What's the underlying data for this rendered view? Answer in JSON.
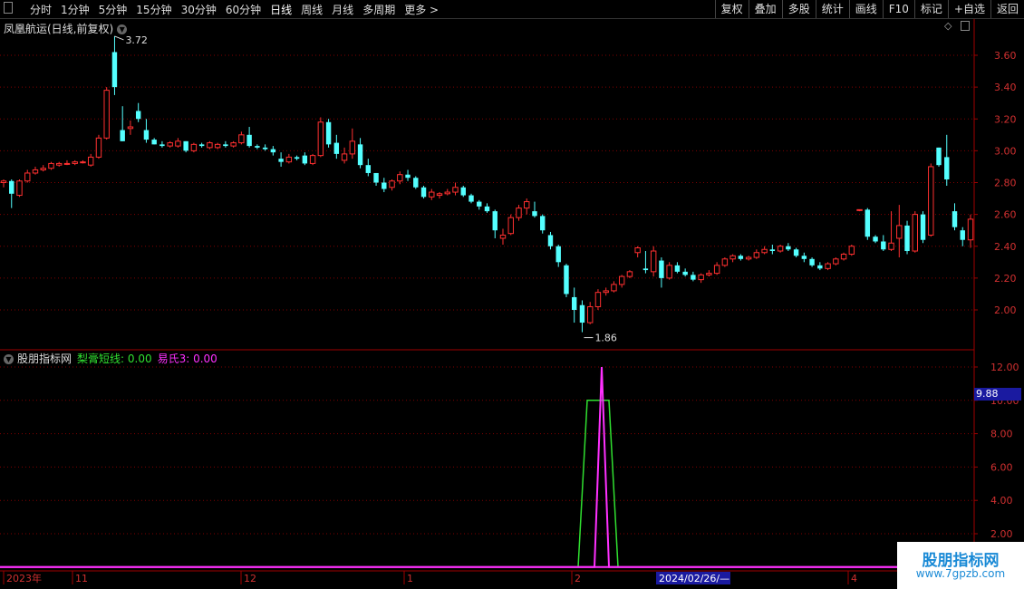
{
  "toolbar": {
    "timeframes": [
      "分时",
      "1分钟",
      "5分钟",
      "15分钟",
      "30分钟",
      "60分钟",
      "日线",
      "周线",
      "月线",
      "多周期",
      "更多 >"
    ],
    "active_timeframe": "日线",
    "tools": [
      "复权",
      "叠加",
      "多股",
      "统计",
      "画线",
      "F10",
      "标记",
      "+自选",
      "返回"
    ]
  },
  "main_chart": {
    "title": "凤凰航运(日线,前复权)",
    "high_label": "3.72",
    "low_label": "1.86",
    "y_ticks": [
      "3.60",
      "3.40",
      "3.20",
      "3.00",
      "2.80",
      "2.60",
      "2.40",
      "2.20",
      "2.00"
    ]
  },
  "indicator": {
    "name": "股朋指标网",
    "series1": "梨膏短线: 0.00",
    "series2": "易氏3: 0.00",
    "y_ticks": [
      "12.00",
      "10.00",
      "8.00",
      "6.00",
      "4.00",
      "2.00"
    ],
    "current_value": "9.88"
  },
  "x_axis": {
    "labels": [
      "2023年",
      "11",
      "12",
      "1",
      "2",
      "4"
    ],
    "cursor_date": "2024/02/26/—"
  },
  "watermark": {
    "title": "股朋指标网",
    "url": "www.7gpzb.com"
  },
  "colors": {
    "up": "#ff3030",
    "down": "#54ffff",
    "grid": "#800000",
    "indicator_green": "#30e030",
    "indicator_magenta": "#ff30ff"
  },
  "chart_data": {
    "type": "candlestick",
    "y_range": [
      1.85,
      3.75
    ],
    "candles": [
      [
        2.8,
        2.82,
        2.77,
        2.81
      ],
      [
        2.81,
        2.82,
        2.64,
        2.73
      ],
      [
        2.72,
        2.82,
        2.71,
        2.81
      ],
      [
        2.81,
        2.88,
        2.8,
        2.86
      ],
      [
        2.86,
        2.9,
        2.85,
        2.88
      ],
      [
        2.88,
        2.91,
        2.87,
        2.89
      ],
      [
        2.89,
        2.93,
        2.88,
        2.92
      ],
      [
        2.91,
        2.93,
        2.9,
        2.92
      ],
      [
        2.92,
        2.94,
        2.91,
        2.92
      ],
      [
        2.92,
        2.94,
        2.91,
        2.93
      ],
      [
        2.93,
        2.94,
        2.92,
        2.93
      ],
      [
        2.91,
        2.98,
        2.9,
        2.96
      ],
      [
        2.96,
        3.1,
        2.95,
        3.08
      ],
      [
        3.08,
        3.4,
        3.07,
        3.38
      ],
      [
        3.62,
        3.72,
        3.35,
        3.4
      ],
      [
        3.13,
        3.28,
        3.06,
        3.06
      ],
      [
        3.14,
        3.19,
        3.1,
        3.15
      ],
      [
        3.25,
        3.3,
        3.18,
        3.2
      ],
      [
        3.13,
        3.2,
        3.05,
        3.07
      ],
      [
        3.07,
        3.08,
        3.04,
        3.04
      ],
      [
        3.04,
        3.06,
        3.02,
        3.03
      ],
      [
        3.03,
        3.06,
        3.02,
        3.05
      ],
      [
        3.03,
        3.08,
        3.02,
        3.06
      ],
      [
        3.06,
        3.06,
        2.99,
        3.0
      ],
      [
        3.0,
        3.05,
        2.99,
        3.04
      ],
      [
        3.04,
        3.05,
        3.02,
        3.03
      ],
      [
        3.02,
        3.06,
        3.01,
        3.05
      ],
      [
        3.02,
        3.05,
        3.01,
        3.04
      ],
      [
        3.04,
        3.06,
        3.02,
        3.03
      ],
      [
        3.03,
        3.06,
        3.02,
        3.05
      ],
      [
        3.05,
        3.12,
        3.04,
        3.1
      ],
      [
        3.1,
        3.15,
        3.02,
        3.03
      ],
      [
        3.03,
        3.04,
        3.01,
        3.02
      ],
      [
        3.02,
        3.04,
        3.0,
        3.01
      ],
      [
        3.01,
        3.03,
        2.97,
        2.99
      ],
      [
        2.95,
        2.99,
        2.9,
        2.93
      ],
      [
        2.93,
        2.98,
        2.92,
        2.96
      ],
      [
        2.96,
        2.97,
        2.94,
        2.95
      ],
      [
        2.97,
        2.99,
        2.91,
        2.92
      ],
      [
        2.92,
        2.98,
        2.91,
        2.97
      ],
      [
        2.97,
        3.21,
        2.96,
        3.18
      ],
      [
        3.18,
        3.2,
        3.02,
        3.04
      ],
      [
        3.05,
        3.1,
        2.95,
        2.98
      ],
      [
        2.94,
        3.02,
        2.92,
        2.98
      ],
      [
        2.98,
        3.14,
        2.95,
        3.06
      ],
      [
        3.04,
        3.08,
        2.89,
        2.91
      ],
      [
        2.91,
        2.95,
        2.84,
        2.86
      ],
      [
        2.86,
        2.86,
        2.78,
        2.8
      ],
      [
        2.8,
        2.83,
        2.74,
        2.76
      ],
      [
        2.77,
        2.82,
        2.75,
        2.81
      ],
      [
        2.81,
        2.87,
        2.79,
        2.85
      ],
      [
        2.85,
        2.88,
        2.81,
        2.83
      ],
      [
        2.83,
        2.84,
        2.76,
        2.77
      ],
      [
        2.77,
        2.78,
        2.7,
        2.71
      ],
      [
        2.71,
        2.76,
        2.69,
        2.74
      ],
      [
        2.72,
        2.74,
        2.7,
        2.73
      ],
      [
        2.73,
        2.76,
        2.72,
        2.74
      ],
      [
        2.74,
        2.8,
        2.72,
        2.77
      ],
      [
        2.77,
        2.78,
        2.71,
        2.72
      ],
      [
        2.72,
        2.73,
        2.67,
        2.68
      ],
      [
        2.68,
        2.69,
        2.63,
        2.65
      ],
      [
        2.65,
        2.67,
        2.61,
        2.62
      ],
      [
        2.62,
        2.63,
        2.45,
        2.5
      ],
      [
        2.45,
        2.51,
        2.41,
        2.47
      ],
      [
        2.48,
        2.6,
        2.47,
        2.58
      ],
      [
        2.58,
        2.66,
        2.56,
        2.64
      ],
      [
        2.64,
        2.7,
        2.6,
        2.68
      ],
      [
        2.62,
        2.68,
        2.58,
        2.59
      ],
      [
        2.59,
        2.6,
        2.48,
        2.5
      ],
      [
        2.47,
        2.49,
        2.38,
        2.4
      ],
      [
        2.4,
        2.41,
        2.27,
        2.3
      ],
      [
        2.28,
        2.29,
        2.08,
        2.1
      ],
      [
        2.08,
        2.14,
        1.92,
        2.0
      ],
      [
        2.03,
        2.06,
        1.86,
        1.92
      ],
      [
        1.92,
        2.05,
        1.91,
        2.02
      ],
      [
        2.02,
        2.13,
        2.0,
        2.11
      ],
      [
        2.11,
        2.14,
        2.09,
        2.12
      ],
      [
        2.12,
        2.18,
        2.11,
        2.16
      ],
      [
        2.16,
        2.22,
        2.14,
        2.21
      ],
      [
        2.21,
        2.25,
        2.2,
        2.24
      ],
      [
        2.36,
        2.4,
        2.33,
        2.39
      ],
      [
        2.26,
        2.37,
        2.23,
        2.25
      ],
      [
        2.24,
        2.4,
        2.21,
        2.37
      ],
      [
        2.31,
        2.33,
        2.14,
        2.2
      ],
      [
        2.2,
        2.3,
        2.19,
        2.28
      ],
      [
        2.28,
        2.3,
        2.23,
        2.24
      ],
      [
        2.24,
        2.26,
        2.21,
        2.22
      ],
      [
        2.22,
        2.24,
        2.18,
        2.19
      ],
      [
        2.19,
        2.23,
        2.17,
        2.22
      ],
      [
        2.22,
        2.25,
        2.21,
        2.23
      ],
      [
        2.23,
        2.3,
        2.22,
        2.28
      ],
      [
        2.28,
        2.33,
        2.27,
        2.32
      ],
      [
        2.32,
        2.35,
        2.3,
        2.34
      ],
      [
        2.34,
        2.35,
        2.31,
        2.32
      ],
      [
        2.32,
        2.34,
        2.31,
        2.33
      ],
      [
        2.33,
        2.38,
        2.32,
        2.36
      ],
      [
        2.36,
        2.4,
        2.35,
        2.38
      ],
      [
        2.38,
        2.41,
        2.35,
        2.37
      ],
      [
        2.37,
        2.41,
        2.36,
        2.4
      ],
      [
        2.4,
        2.42,
        2.37,
        2.38
      ],
      [
        2.38,
        2.39,
        2.33,
        2.34
      ],
      [
        2.34,
        2.36,
        2.3,
        2.32
      ],
      [
        2.32,
        2.33,
        2.27,
        2.28
      ],
      [
        2.28,
        2.3,
        2.25,
        2.26
      ],
      [
        2.26,
        2.3,
        2.25,
        2.29
      ],
      [
        2.29,
        2.33,
        2.28,
        2.32
      ],
      [
        2.32,
        2.36,
        2.31,
        2.35
      ],
      [
        2.35,
        2.41,
        2.34,
        2.4
      ],
      [
        2.63,
        2.63,
        2.62,
        2.63
      ],
      [
        2.63,
        2.64,
        2.44,
        2.46
      ],
      [
        2.46,
        2.47,
        2.42,
        2.43
      ],
      [
        2.43,
        2.47,
        2.37,
        2.38
      ],
      [
        2.38,
        2.62,
        2.37,
        2.42
      ],
      [
        2.45,
        2.66,
        2.33,
        2.53
      ],
      [
        2.53,
        2.56,
        2.35,
        2.37
      ],
      [
        2.37,
        2.62,
        2.36,
        2.6
      ],
      [
        2.6,
        2.62,
        2.42,
        2.44
      ],
      [
        2.47,
        2.92,
        2.46,
        2.9
      ],
      [
        3.02,
        3.02,
        2.9,
        2.91
      ],
      [
        2.96,
        3.1,
        2.78,
        2.82
      ],
      [
        2.62,
        2.67,
        2.5,
        2.52
      ],
      [
        2.5,
        2.52,
        2.4,
        2.44
      ],
      [
        2.44,
        2.6,
        2.39,
        2.57
      ]
    ],
    "indicator": {
      "series": [
        {
          "name": "梨膏短线",
          "values": [
            0,
            0,
            0,
            0,
            0,
            0,
            10,
            10,
            0,
            0,
            0
          ]
        },
        {
          "name": "易氏3",
          "values": [
            0,
            0,
            0,
            0,
            0,
            0,
            12,
            0,
            0,
            0,
            0
          ]
        }
      ],
      "y_range": [
        0,
        12.5
      ]
    }
  }
}
